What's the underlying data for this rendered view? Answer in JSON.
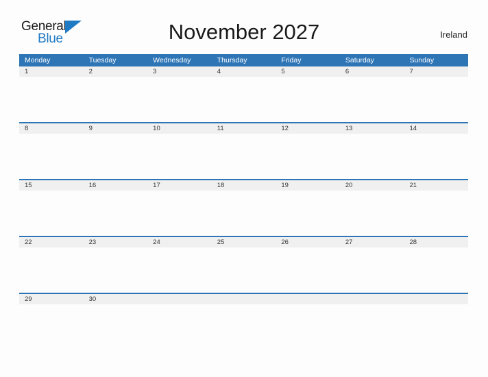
{
  "brand": {
    "name_part1": "General",
    "name_part2": "Blue",
    "flag_icon": "blue-triangle-flag"
  },
  "header": {
    "title": "November 2027",
    "locale": "Ireland"
  },
  "colors": {
    "header_blue": "#2e75b6",
    "date_strip_gray": "#f0f0f0",
    "page_background": "#fdfdfd",
    "brand_blue": "#1f7ac4",
    "text_dark": "#1a1a1a"
  },
  "calendar": {
    "month": "November",
    "year": "2027",
    "weekday_headers": [
      "Monday",
      "Tuesday",
      "Wednesday",
      "Thursday",
      "Friday",
      "Saturday",
      "Sunday"
    ],
    "weeks": [
      {
        "days": [
          "1",
          "2",
          "3",
          "4",
          "5",
          "6",
          "7"
        ]
      },
      {
        "days": [
          "8",
          "9",
          "10",
          "11",
          "12",
          "13",
          "14"
        ]
      },
      {
        "days": [
          "15",
          "16",
          "17",
          "18",
          "19",
          "20",
          "21"
        ]
      },
      {
        "days": [
          "22",
          "23",
          "24",
          "25",
          "26",
          "27",
          "28"
        ]
      },
      {
        "days": [
          "29",
          "30",
          "",
          "",
          "",
          "",
          ""
        ]
      }
    ]
  }
}
